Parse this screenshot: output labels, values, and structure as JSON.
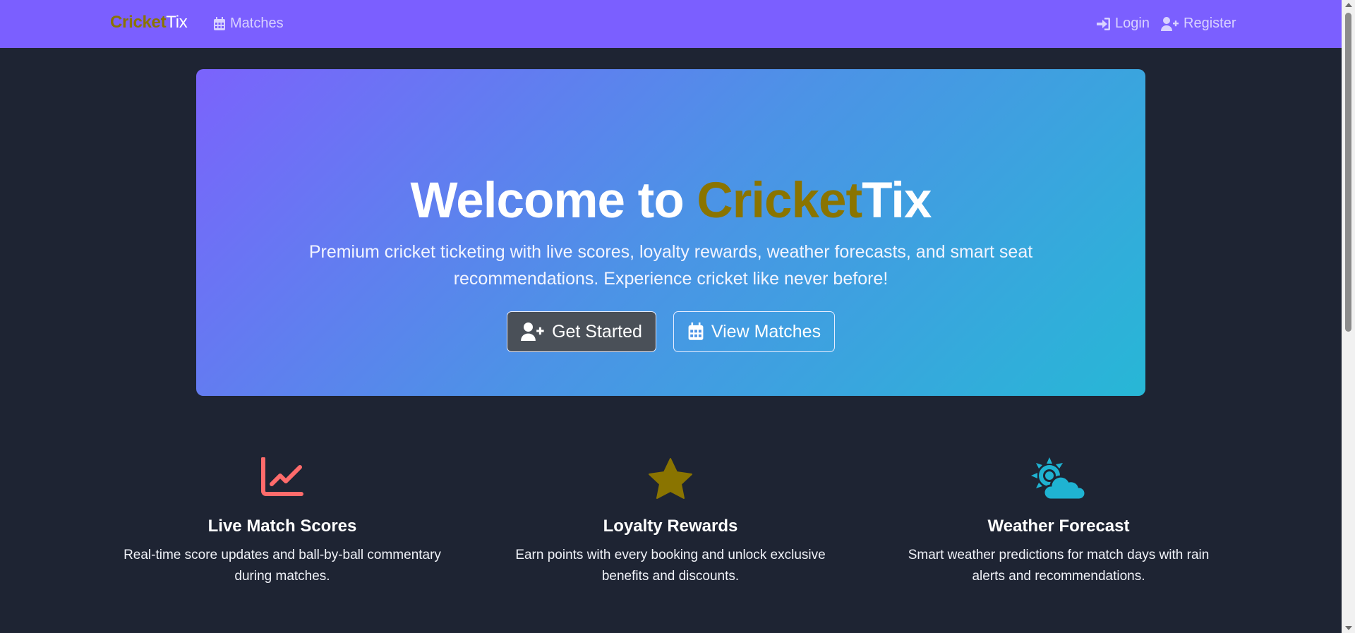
{
  "nav": {
    "brand_gold": "Cricket",
    "brand_white": "Tix",
    "matches": "Matches",
    "login": "Login",
    "register": "Register"
  },
  "hero": {
    "title_prefix": "Welcome to ",
    "title_gold": "Cricket",
    "title_suffix": "Tix",
    "subtitle": "Premium cricket ticketing with live scores, loyalty rewards, weather forecasts, and smart seat recommendations. Experience cricket like never before!",
    "primary_button": "Get Started",
    "secondary_button": "View Matches"
  },
  "features": [
    {
      "icon": "chart-line-icon",
      "color": "#ff6b6b",
      "title": "Live Match Scores",
      "description": "Real-time score updates and ball-by-ball commentary during matches."
    },
    {
      "icon": "star-icon",
      "color": "#8a7400",
      "title": "Loyalty Rewards",
      "description": "Earn points with every booking and unlock exclusive benefits and discounts."
    },
    {
      "icon": "cloud-sun-icon",
      "color": "#1fb3d2",
      "title": "Weather Forecast",
      "description": "Smart weather predictions for match days with rain alerts and recommendations."
    }
  ],
  "colors": {
    "navbar": "#7b5fff",
    "background": "#1e2433",
    "brand_gold": "#8a7400"
  }
}
